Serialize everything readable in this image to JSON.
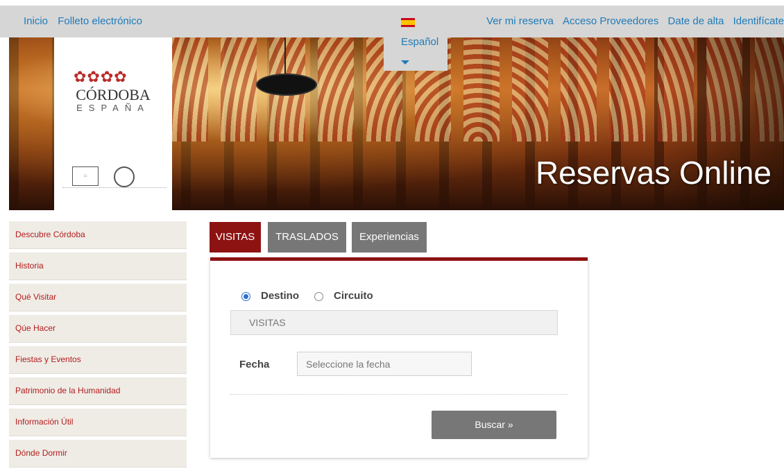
{
  "top_nav": {
    "left": [
      "Inicio",
      "Folleto electrónico"
    ],
    "right": [
      "Ver mi reserva",
      "Acceso Proveedores",
      "Date de alta",
      "Identifícate"
    ]
  },
  "language": {
    "label": "Español"
  },
  "banner": {
    "title": "Reservas Online",
    "logo_city": "CÓRDOBA",
    "logo_country": "ESPAÑA"
  },
  "sidebar": {
    "items": [
      {
        "label": "Descubre Córdoba"
      },
      {
        "label": "Historia"
      },
      {
        "label": "Qué Visitar"
      },
      {
        "label": "Qúe Hacer"
      },
      {
        "label": "Fiestas y Eventos"
      },
      {
        "label": "Patrimonio de la Humanidad"
      },
      {
        "label": "Información Útil"
      },
      {
        "label": "Dónde Dormir"
      }
    ]
  },
  "tabs": [
    {
      "label": "VISITAS",
      "active": true
    },
    {
      "label": "TRASLADOS",
      "active": false
    },
    {
      "label": "Experiencias",
      "active": false
    }
  ],
  "form": {
    "radio_destino": "Destino",
    "radio_circuito": "Circuito",
    "selected_radio": "Destino",
    "select_value": "VISITAS",
    "fecha_label": "Fecha",
    "fecha_placeholder": "Seleccione la fecha",
    "search_button": "Buscar »"
  },
  "colors": {
    "accent": "#8d1212",
    "tab_inactive": "#777777",
    "link": "#1e7bb8",
    "sidebar_text": "#b21c1c"
  }
}
